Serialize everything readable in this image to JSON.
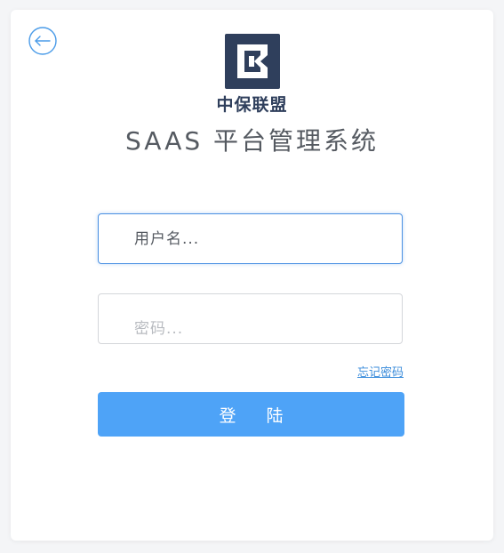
{
  "brand": {
    "name": "中保联盟",
    "title": "SAAS 平台管理系统",
    "logo_color": "#2f3f5c"
  },
  "form": {
    "username_placeholder": "用户名...",
    "password_placeholder": "密码...",
    "forgot_label": "忘记密码",
    "login_label": "登 陆"
  },
  "colors": {
    "accent": "#4ea3f7",
    "focus_border": "#4a90e2",
    "link": "#3c8ddb"
  },
  "icons": {
    "back": "back-arrow-icon",
    "logo": "brand-logo-icon"
  }
}
